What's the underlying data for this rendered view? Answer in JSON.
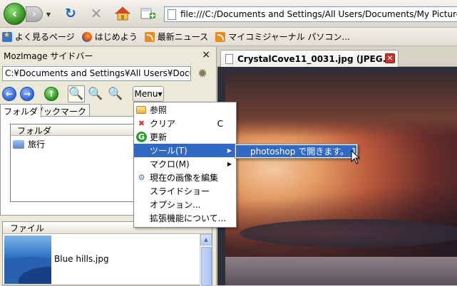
{
  "nav": {
    "back_icon": "back-arrow-icon",
    "forward_icon": "forward-arrow-icon",
    "url": "file:///C:/Documents and Settings/All Users/Documents/My Pictures/Sample"
  },
  "bookmarks": [
    {
      "label": "よく見るページ",
      "icon": "bookmark-star-icon"
    },
    {
      "label": "はじめよう",
      "icon": "firefox-icon"
    },
    {
      "label": "最新ニュース",
      "icon": "rss-icon"
    },
    {
      "label": "マイコミジャーナル パソコン...",
      "icon": "rss-icon"
    }
  ],
  "sidebar": {
    "title": "MozImage サイドバー",
    "close_symbol": "×",
    "path": "C:¥Documents and Settings¥All Users¥Documents¥My Pictures",
    "menu_label": "Menu▾",
    "tabs": [
      "フォルダ",
      "ブックマーク"
    ],
    "folder_column": "フォルダ",
    "folders": [
      "旅行"
    ],
    "file_column": "ファイル",
    "files": [
      "Blue hills.jpg"
    ]
  },
  "tab": {
    "title": "CrystalCove11_0031.jpg (JPEG..."
  },
  "menu": {
    "items": [
      {
        "label": "参照",
        "icon": "folder-open-icon",
        "accel": ""
      },
      {
        "label": "クリア",
        "icon": "clear-icon",
        "accel": "C"
      },
      {
        "label": "更新",
        "icon": "refresh-icon",
        "accel": ""
      },
      {
        "label": "ツール(T)",
        "icon": "",
        "accel": "",
        "submenu": true,
        "highlighted": true
      },
      {
        "label": "マクロ(M)",
        "icon": "",
        "accel": "",
        "submenu": true
      },
      {
        "label": "現在の画像を編集",
        "icon": "edit-gear-icon",
        "accel": ""
      },
      {
        "label": "スライドショー",
        "icon": "",
        "accel": ""
      },
      {
        "label": "オプション...",
        "icon": "",
        "accel": ""
      },
      {
        "label": "拡張機能について...",
        "icon": "",
        "accel": ""
      }
    ],
    "submenu_item": "photoshop で開きます。 1"
  },
  "colors": {
    "highlight": "#316ac5",
    "nav_green": "#2f8a1d",
    "close_red": "#c4332f"
  }
}
